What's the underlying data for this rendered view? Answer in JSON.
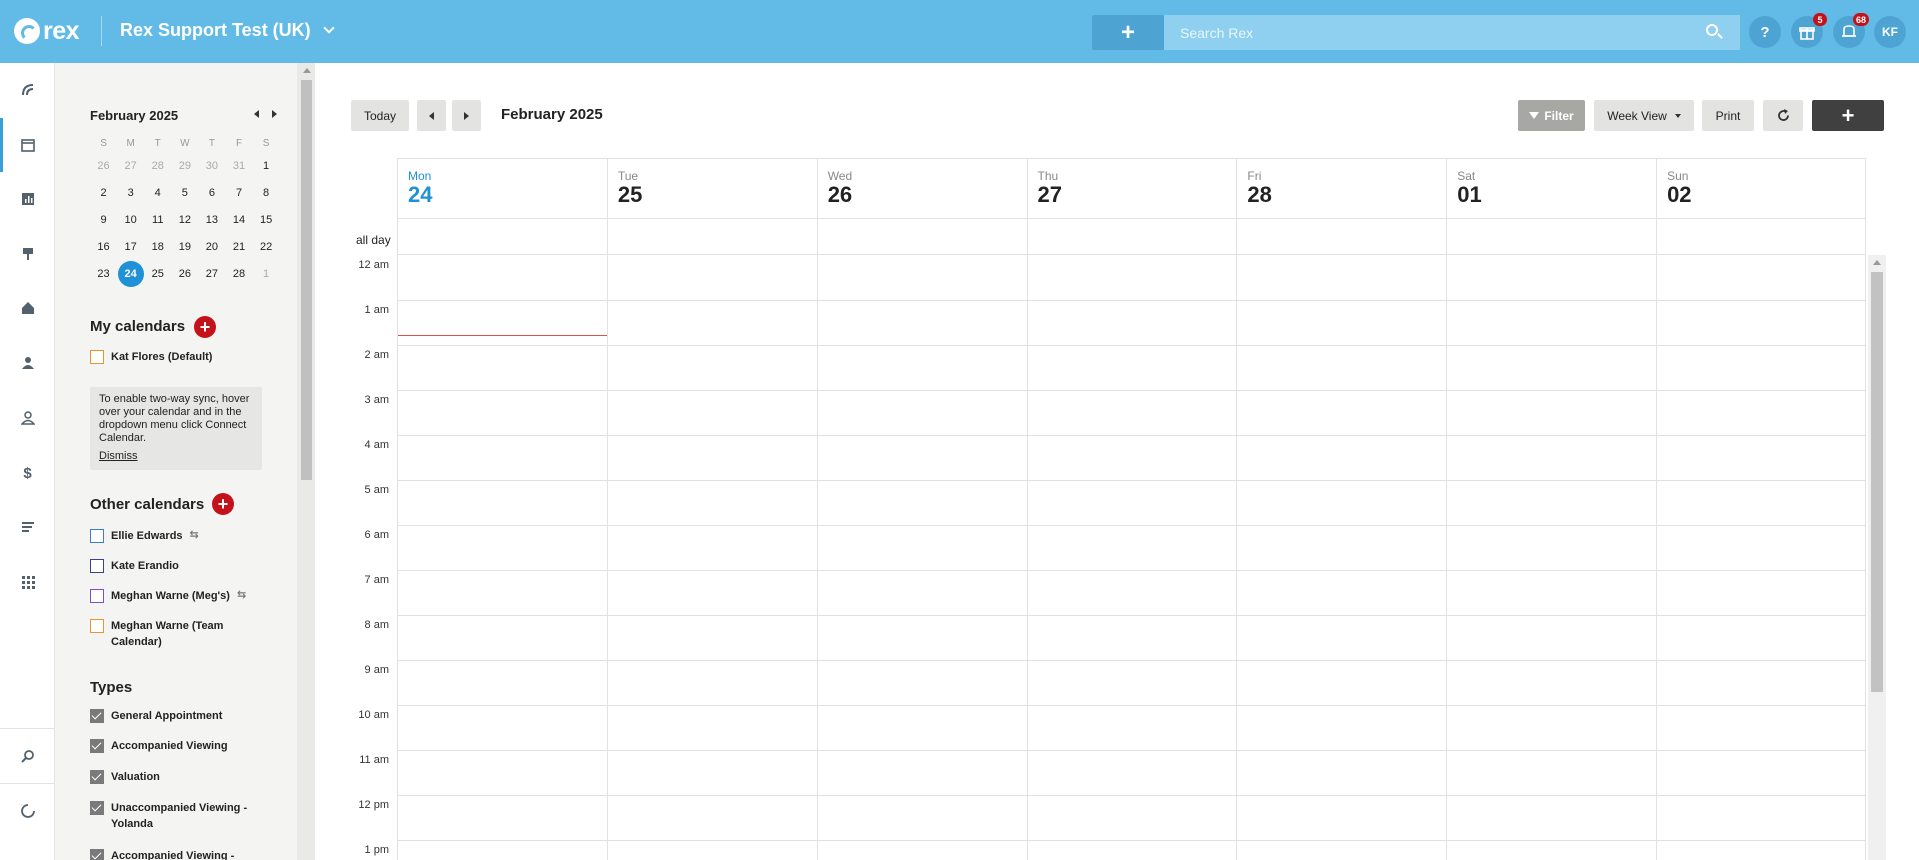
{
  "topbar": {
    "logo_text": "rex",
    "account_name": "Rex Support Test (UK)",
    "add_label": "+",
    "search_placeholder": "Search Rex",
    "help_label": "?",
    "gifts_badge": "5",
    "notifications_badge": "68",
    "user_initials": "KF",
    "color": "#62bbe7"
  },
  "leftnav": {
    "icons": [
      "rex-logo-icon",
      "calendar-icon",
      "reports-icon",
      "listings-icon",
      "properties-icon",
      "contacts-icon",
      "leads-icon",
      "financials-icon",
      "feed-icon",
      "apps-icon",
      "search-extra-icon",
      "loading-icon"
    ]
  },
  "mini_calendar": {
    "title": "February 2025",
    "weekdays": [
      "S",
      "M",
      "T",
      "W",
      "T",
      "F",
      "S"
    ],
    "weeks": [
      [
        {
          "d": "26",
          "o": true
        },
        {
          "d": "27",
          "o": true
        },
        {
          "d": "28",
          "o": true
        },
        {
          "d": "29",
          "o": true
        },
        {
          "d": "30",
          "o": true
        },
        {
          "d": "31",
          "o": true
        },
        {
          "d": "1"
        }
      ],
      [
        {
          "d": "2"
        },
        {
          "d": "3"
        },
        {
          "d": "4"
        },
        {
          "d": "5"
        },
        {
          "d": "6"
        },
        {
          "d": "7"
        },
        {
          "d": "8"
        }
      ],
      [
        {
          "d": "9"
        },
        {
          "d": "10"
        },
        {
          "d": "11"
        },
        {
          "d": "12"
        },
        {
          "d": "13"
        },
        {
          "d": "14"
        },
        {
          "d": "15"
        }
      ],
      [
        {
          "d": "16"
        },
        {
          "d": "17"
        },
        {
          "d": "18"
        },
        {
          "d": "19"
        },
        {
          "d": "20"
        },
        {
          "d": "21"
        },
        {
          "d": "22"
        }
      ],
      [
        {
          "d": "23"
        },
        {
          "d": "24",
          "s": true
        },
        {
          "d": "25"
        },
        {
          "d": "26"
        },
        {
          "d": "27"
        },
        {
          "d": "28"
        },
        {
          "d": "1",
          "o": true
        }
      ]
    ]
  },
  "my_calendars": {
    "title": "My calendars",
    "items": [
      {
        "label": "Kat Flores (Default)",
        "color": "#e8952f"
      }
    ],
    "info_text": "To enable two-way sync, hover over your calendar and in the dropdown menu click Connect Calendar.",
    "dismiss_label": "Dismiss"
  },
  "other_calendars": {
    "title": "Other calendars",
    "items": [
      {
        "label": "Ellie Edwards",
        "color": "#3a7fd1",
        "synced": true
      },
      {
        "label": "Kate Erandio",
        "color": "#3b3f9a",
        "synced": false
      },
      {
        "label": "Meghan Warne (Meg's)",
        "color": "#7a4fc9",
        "synced": true
      },
      {
        "label": "Meghan Warne (Team Calendar)",
        "color": "#e8952f",
        "synced": false
      }
    ]
  },
  "types": {
    "title": "Types",
    "items": [
      {
        "label": "General Appointment"
      },
      {
        "label": "Accompanied Viewing"
      },
      {
        "label": "Valuation"
      },
      {
        "label": "Unaccompanied Viewing - Yolanda"
      },
      {
        "label": "Accompanied Viewing -"
      }
    ]
  },
  "toolbar": {
    "today_label": "Today",
    "title": "February 2025",
    "filter_label": "Filter",
    "view_label": "Week View",
    "print_label": "Print",
    "new_label": "+"
  },
  "week": {
    "days": [
      {
        "name": "Mon",
        "num": "24",
        "today": true
      },
      {
        "name": "Tue",
        "num": "25"
      },
      {
        "name": "Wed",
        "num": "26"
      },
      {
        "name": "Thu",
        "num": "27"
      },
      {
        "name": "Fri",
        "num": "28"
      },
      {
        "name": "Sat",
        "num": "01"
      },
      {
        "name": "Sun",
        "num": "02"
      }
    ],
    "allday_label": "all day",
    "hours": [
      "12 am",
      "1 am",
      "2 am",
      "3 am",
      "4 am",
      "5 am",
      "6 am",
      "7 am",
      "8 am",
      "9 am",
      "10 am",
      "11 am",
      "12 pm",
      "1 pm"
    ]
  }
}
